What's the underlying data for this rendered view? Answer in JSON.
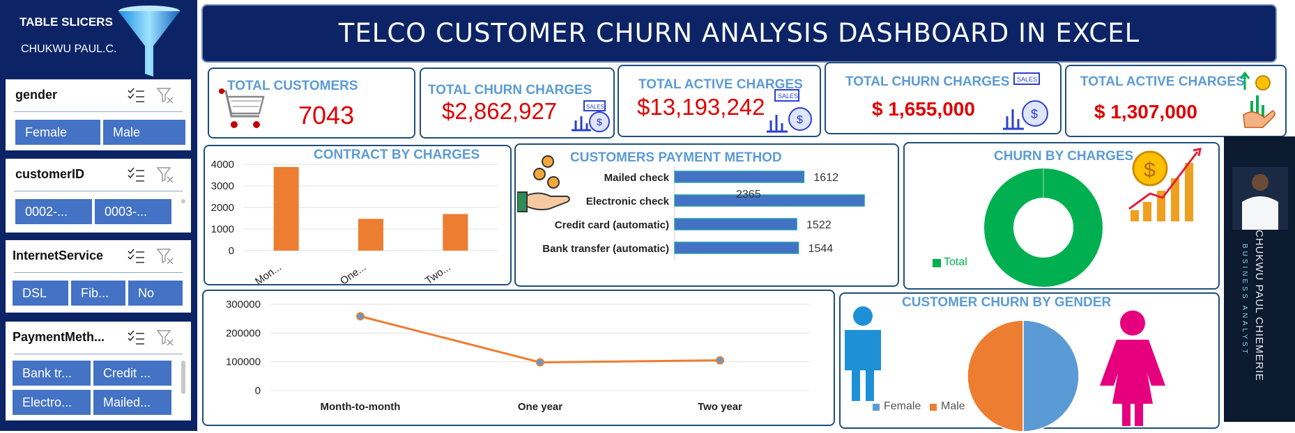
{
  "sidebar": {
    "title": "TABLE SLICERS",
    "author": "CHUKWU PAUL.C.",
    "slicers": [
      {
        "field": "gender",
        "items": [
          "Female",
          "Male"
        ]
      },
      {
        "field": "customerID",
        "items": [
          "0002-...",
          "0003-..."
        ]
      },
      {
        "field": "InternetService",
        "items": [
          "DSL",
          "Fib...",
          "No"
        ]
      },
      {
        "field": "PaymentMeth...",
        "items": [
          "Bank tr...",
          "Credit ...",
          "Electro...",
          "Mailed..."
        ]
      }
    ]
  },
  "header": {
    "title": "TELCO CUSTOMER CHURN ANALYSIS DASHBOARD IN EXCEL"
  },
  "kpis": [
    {
      "label": "TOTAL CUSTOMERS",
      "value": "7043"
    },
    {
      "label": "TOTAL CHURN CHARGES",
      "value": "$2,862,927"
    },
    {
      "label": "TOTAL ACTIVE CHARGES",
      "value": "$13,193,242"
    },
    {
      "label": "TOTAL CHURN CHARGES",
      "value": "$ 1,655,000"
    },
    {
      "label": "TOTAL ACTIVE CHARGES",
      "value": "$ 1,307,000"
    }
  ],
  "colors": {
    "navy": "#0c2466",
    "accent_blue": "#5b9bd5",
    "bar_orange": "#ed7d31",
    "bar_blue": "#4472c4",
    "donut_green": "#00b050",
    "kpi_red": "#e00000",
    "female_pink": "#e6007e",
    "male_blue": "#1e90d6"
  },
  "chart_data": [
    {
      "type": "bar",
      "title": "CONTRACT BY CHARGES",
      "categories": [
        "Mon...",
        "One...",
        "Two..."
      ],
      "values": [
        3875,
        1473,
        1695
      ],
      "ylim": [
        0,
        4000
      ],
      "yticks": [
        "4000",
        "3000",
        "2000",
        "1000",
        "0"
      ]
    },
    {
      "type": "bar",
      "orientation": "horizontal",
      "title": "CUSTOMERS PAYMENT METHOD",
      "categories": [
        "Mailed check",
        "Electronic check",
        "Credit card (automatic)",
        "Bank transfer (automatic)"
      ],
      "values": [
        1612,
        2365,
        1522,
        1544
      ],
      "labels": [
        "1612",
        "2365",
        "1522",
        "1544"
      ]
    },
    {
      "type": "pie",
      "title": "CHURN BY CHARGES",
      "series": [
        {
          "name": "Total",
          "values": [
            100
          ]
        }
      ],
      "legend": [
        "Total"
      ]
    },
    {
      "type": "line",
      "categories": [
        "Month-to-month",
        "One year",
        "Two year"
      ],
      "values": [
        258000,
        98000,
        105000
      ],
      "ylim": [
        0,
        300000
      ],
      "yticks": [
        "300000",
        "200000",
        "100000",
        "0"
      ]
    },
    {
      "type": "pie",
      "title": "CUSTOMER CHURN BY GENDER",
      "categories": [
        "Female",
        "Male"
      ],
      "values": [
        50,
        50
      ]
    }
  ],
  "photo": {
    "name": "CHUKWU PAUL CHIEMERIE",
    "role": "BUSINESS ANALYST"
  }
}
